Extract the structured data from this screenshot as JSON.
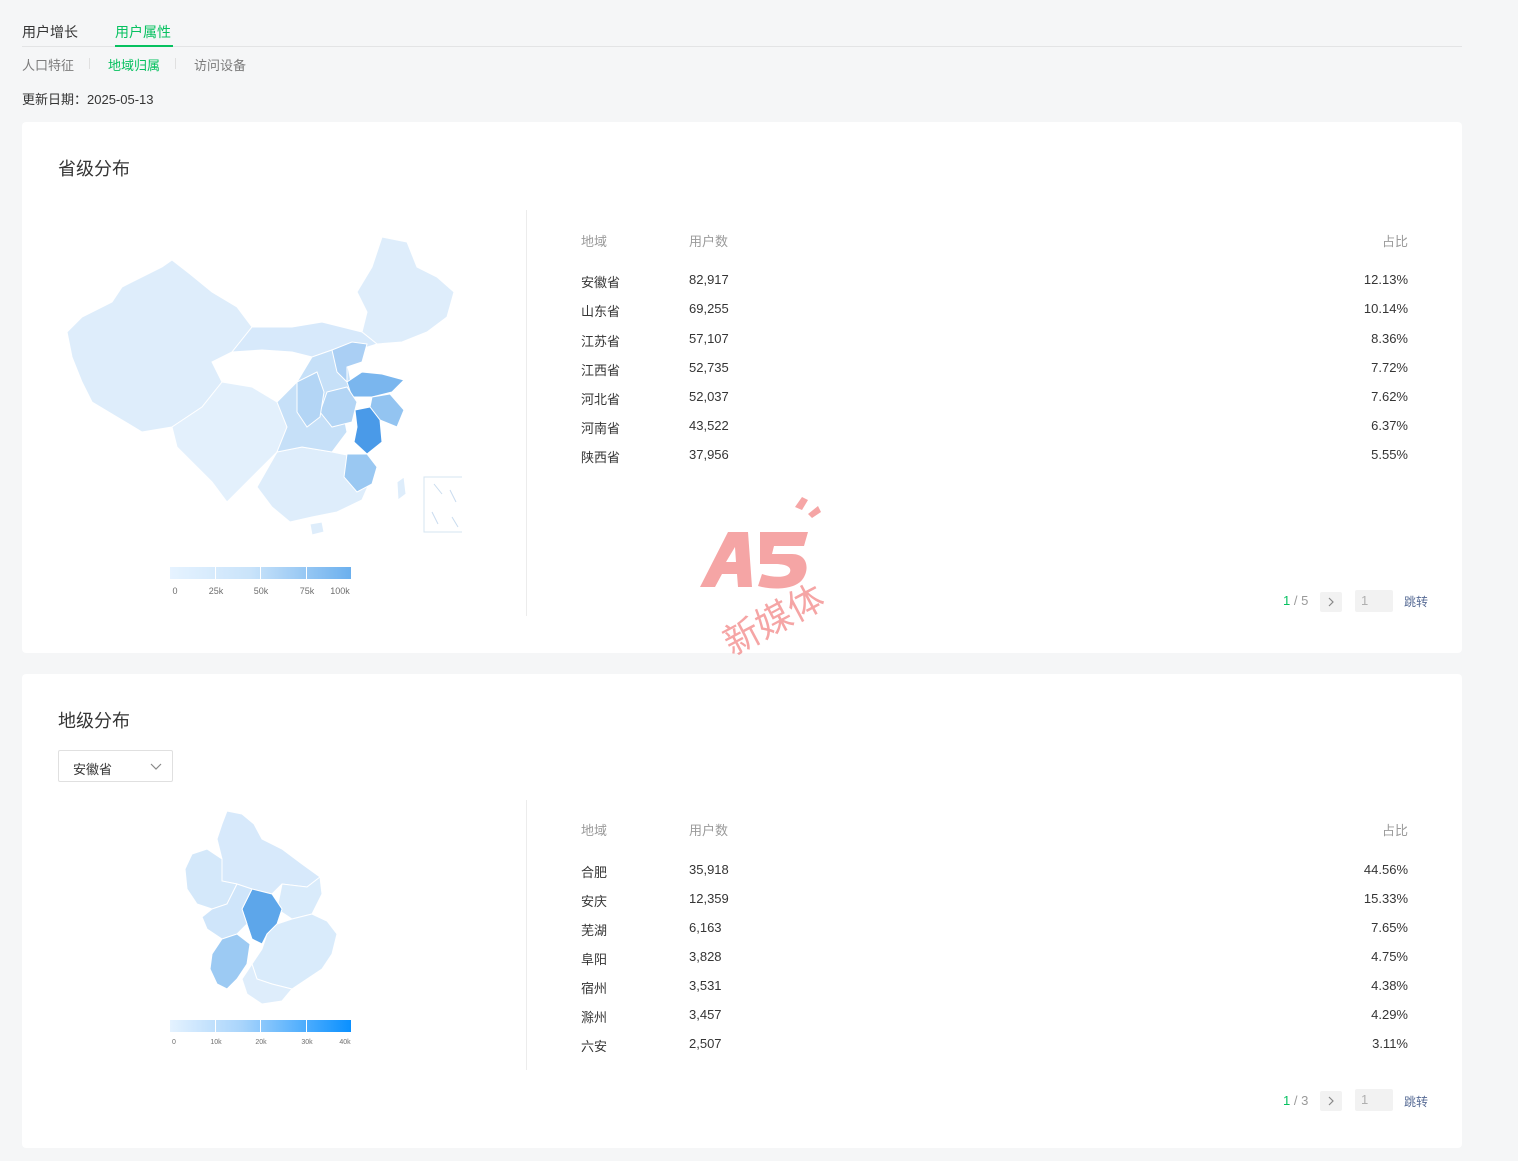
{
  "tabs": [
    {
      "label": "用户增长",
      "active": false
    },
    {
      "label": "用户属性",
      "active": true
    }
  ],
  "subtabs": [
    {
      "label": "人口特征",
      "active": false
    },
    {
      "label": "地域归属",
      "active": true
    },
    {
      "label": "访问设备",
      "active": false
    }
  ],
  "update": {
    "label": "更新日期：",
    "date": "2025-05-13"
  },
  "province_card": {
    "title": "省级分布",
    "columns": {
      "region": "地域",
      "users": "用户数",
      "ratio": "占比"
    },
    "rows": [
      {
        "region": "安徽省",
        "users": "82,917",
        "ratio": "12.13%"
      },
      {
        "region": "山东省",
        "users": "69,255",
        "ratio": "10.14%"
      },
      {
        "region": "江苏省",
        "users": "57,107",
        "ratio": "8.36%"
      },
      {
        "region": "江西省",
        "users": "52,735",
        "ratio": "7.72%"
      },
      {
        "region": "河北省",
        "users": "52,037",
        "ratio": "7.62%"
      },
      {
        "region": "河南省",
        "users": "43,522",
        "ratio": "6.37%"
      },
      {
        "region": "陕西省",
        "users": "37,956",
        "ratio": "5.55%"
      }
    ],
    "legend": [
      "0",
      "25k",
      "50k",
      "75k",
      "100k"
    ],
    "pager": {
      "current": "1",
      "total": "/ 5",
      "input": "1",
      "jump": "跳转",
      "next_icon": "chevron-right-icon"
    }
  },
  "city_card": {
    "title": "地级分布",
    "select": {
      "value": "安徽省",
      "icon": "chevron-down-icon"
    },
    "columns": {
      "region": "地域",
      "users": "用户数",
      "ratio": "占比"
    },
    "rows": [
      {
        "region": "合肥",
        "users": "35,918",
        "ratio": "44.56%"
      },
      {
        "region": "安庆",
        "users": "12,359",
        "ratio": "15.33%"
      },
      {
        "region": "芜湖",
        "users": "6,163",
        "ratio": "7.65%"
      },
      {
        "region": "阜阳",
        "users": "3,828",
        "ratio": "4.75%"
      },
      {
        "region": "宿州",
        "users": "3,531",
        "ratio": "4.38%"
      },
      {
        "region": "滁州",
        "users": "3,457",
        "ratio": "4.29%"
      },
      {
        "region": "六安",
        "users": "2,507",
        "ratio": "3.11%"
      }
    ],
    "legend": [
      "0",
      "10k",
      "20k",
      "30k",
      "40k"
    ],
    "pager": {
      "current": "1",
      "total": "/ 3",
      "input": "1",
      "jump": "跳转",
      "next_icon": "chevron-right-icon"
    }
  },
  "watermark": {
    "brand": "A5",
    "text": "新媒体"
  },
  "colors": {
    "accent": "#07c160",
    "map_light": "#deedfb",
    "map_mid": "#b7d8f6",
    "map_dark": "#6aaeec",
    "map_darkest": "#4a9ae8",
    "legend_max": "#0a90ff"
  }
}
